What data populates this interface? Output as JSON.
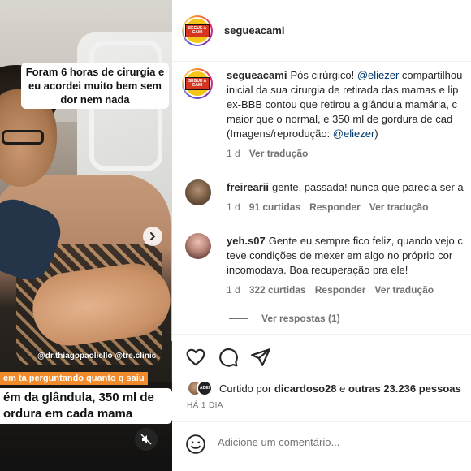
{
  "media": {
    "caption_top": "Foram 6 horas de cirurgia e eu acordei muito bem sem dor nem nada",
    "credit": "@dr.thiagopaoliello @tre.clinic",
    "caption_orange": "em ta perguntando quanto q saiu",
    "caption_bottom": "ém da glândula, 350 ml de ordura em cada mama"
  },
  "header": {
    "username": "segueacami",
    "avatar_logo_text": "SEGUE A CAMI"
  },
  "caption": {
    "username": "segueacami",
    "line1_pre": "Pós cirúrgico! ",
    "line1_mention": "@eliezer",
    "line1_post": " compartilhou",
    "line2": "inicial da sua cirurgia de retirada das mamas e lip",
    "line3": "ex-BBB contou que retirou a glândula mamária, c",
    "line4": "maior que o normal, e 350 ml de gordura de cad",
    "line5_pre": "(Imagens/reprodução: ",
    "line5_mention": "@eliezer",
    "line5_post": ")",
    "time": "1 d",
    "translate": "Ver tradução"
  },
  "comments": [
    {
      "username": "freirearii",
      "text": "gente, passada! nunca que parecia ser a",
      "time": "1 d",
      "likes": "91 curtidas",
      "reply": "Responder",
      "translate": "Ver tradução"
    },
    {
      "username": "yeh.s07",
      "line1": "Gente eu sempre fico feliz, quando vejo c",
      "line2": "teve condições de mexer em algo no próprio cor",
      "line3": "incomodava. Boa recuperação pra ele!",
      "time": "1 d",
      "likes": "322 curtidas",
      "reply": "Responder",
      "translate": "Ver tradução"
    }
  ],
  "more_replies": "Ver respostas (1)",
  "likes": {
    "prefix": "Curtido por ",
    "user": "dicardoso28",
    "middle": " e ",
    "others": "outras 23.236 pessoas",
    "avatar2_text": "ADEI"
  },
  "time_ago": "HÁ 1 DIA",
  "add_comment": {
    "placeholder": "Adicione um comentário..."
  }
}
